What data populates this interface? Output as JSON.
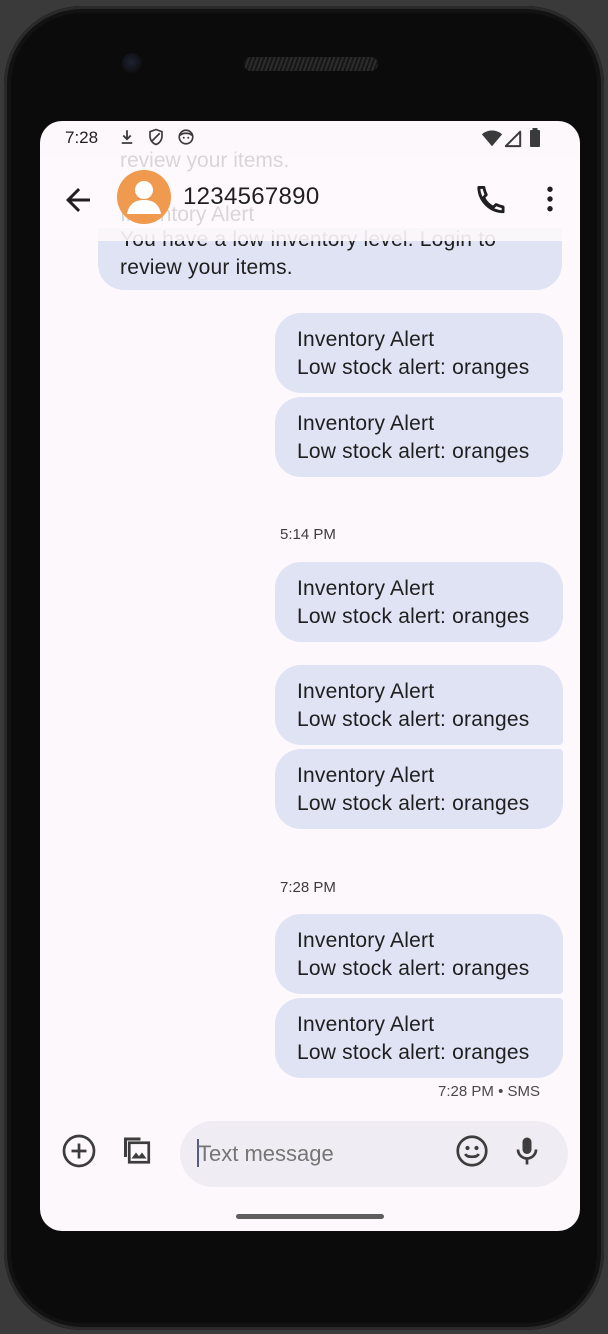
{
  "status_bar": {
    "time": "7:28",
    "left_icons": [
      "download-icon",
      "shield-icon",
      "face-icon"
    ],
    "right_icons": [
      "wifi-icon",
      "signal-icon",
      "battery-icon"
    ]
  },
  "header": {
    "contact_name": "1234567890",
    "avatar_color": "#ef9a4f",
    "ghost_line_1": "review your items.",
    "ghost_line_2": "Inventory Alert"
  },
  "messages": {
    "incoming_partial": {
      "line1": "You have a low inventory level. Login to",
      "line2": "review your items."
    },
    "group1": [
      {
        "title": "Inventory Alert",
        "body": "Low stock alert: oranges"
      },
      {
        "title": "Inventory Alert",
        "body": "Low stock alert: oranges"
      }
    ],
    "timestamp_2": "5:14 PM",
    "group2_single": {
      "title": "Inventory Alert",
      "body": "Low stock alert: oranges"
    },
    "group3": [
      {
        "title": "Inventory Alert",
        "body": "Low stock alert: oranges"
      },
      {
        "title": "Inventory Alert",
        "body": "Low stock alert: oranges"
      }
    ],
    "timestamp_3": "7:28 PM",
    "group4": [
      {
        "title": "Inventory Alert",
        "body": "Low stock alert: oranges"
      },
      {
        "title": "Inventory Alert",
        "body": "Low stock alert: oranges"
      }
    ],
    "last_meta": "7:28 PM • SMS"
  },
  "compose": {
    "placeholder": "Text message",
    "icons": [
      "add-icon",
      "gallery-icon",
      "emoji-icon",
      "mic-icon"
    ]
  },
  "colors": {
    "bubble": "#dfe3f4",
    "screen_bg": "#fdf8fc",
    "avatar": "#ef9a4f"
  }
}
